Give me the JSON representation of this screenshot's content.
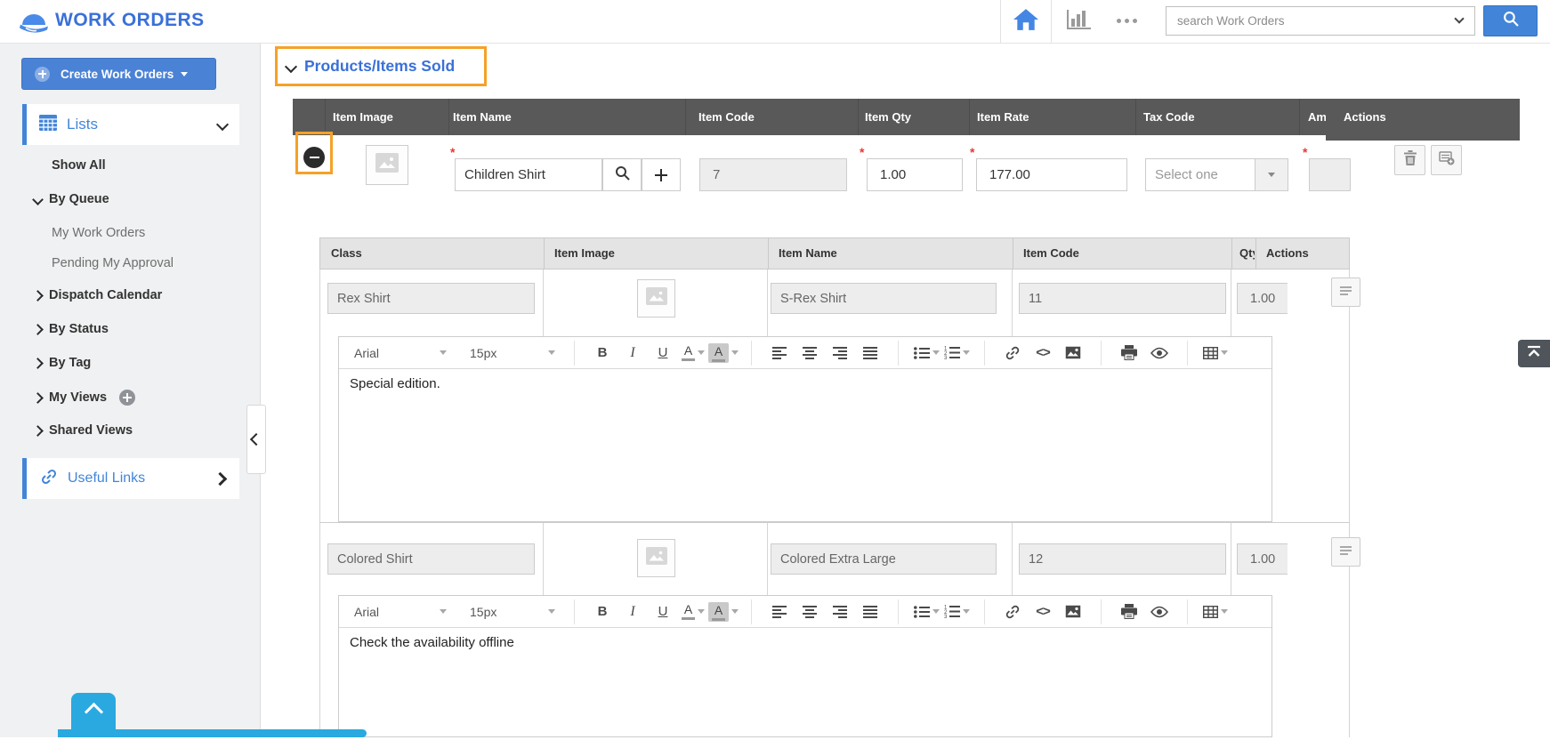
{
  "header": {
    "title": "WORK ORDERS",
    "search": {
      "placeholder": "search Work Orders"
    }
  },
  "sidebar": {
    "create_button": {
      "label": "Create Work Orders"
    },
    "lists": {
      "label": "Lists"
    },
    "nav": [
      {
        "label": "Show All"
      },
      {
        "label": "By Queue"
      },
      {
        "label": "My Work Orders"
      },
      {
        "label": "Pending My Approval"
      },
      {
        "label": "Dispatch Calendar"
      },
      {
        "label": "By Status"
      },
      {
        "label": "By Tag"
      },
      {
        "label": "My Views"
      },
      {
        "label": "Shared Views"
      }
    ],
    "useful_links": {
      "label": "Useful Links"
    }
  },
  "main": {
    "section": {
      "title": "Products/Items Sold"
    },
    "required_marker": "*",
    "items_table": {
      "headers": {
        "item_image": "Item Image",
        "item_name": "Item Name",
        "item_code": "Item Code",
        "item_qty": "Item Qty",
        "item_rate": "Item Rate",
        "tax_code": "Tax Code",
        "amount": "Amount",
        "actions": "Actions"
      },
      "row": {
        "item_name": "Children Shirt",
        "item_code": "7",
        "item_qty": "1.00",
        "item_rate": "177.00",
        "tax_code_selected": "Select one",
        "amount": ""
      }
    },
    "class_table": {
      "headers": {
        "class": "Class",
        "item_image": "Item Image",
        "item_name": "Item Name",
        "item_code": "Item Code",
        "qty": "Qty",
        "actions": "Actions"
      },
      "rows": [
        {
          "class": "Rex Shirt",
          "item_name": "S-Rex Shirt",
          "item_code": "11",
          "qty": "1.00",
          "description": "Special edition."
        },
        {
          "class": "Colored Shirt",
          "item_name": "Colored Extra Large",
          "item_code": "12",
          "qty": "1.00",
          "description": "Check the availability offline"
        }
      ]
    },
    "editor_toolbar": {
      "font_name": "Arial",
      "font_size": "15px",
      "bold": "B",
      "italic": "I",
      "underline": "U",
      "fore_color": "A",
      "back_color": "A",
      "code_view": "<>"
    }
  },
  "colors": {
    "brand_blue": "#3a70d9",
    "accent_blue": "#4285d6",
    "annotation_orange": "#f5a128",
    "table_header_gray": "#595959",
    "cyan": "#29a9e0",
    "required_red": "#e53935"
  }
}
